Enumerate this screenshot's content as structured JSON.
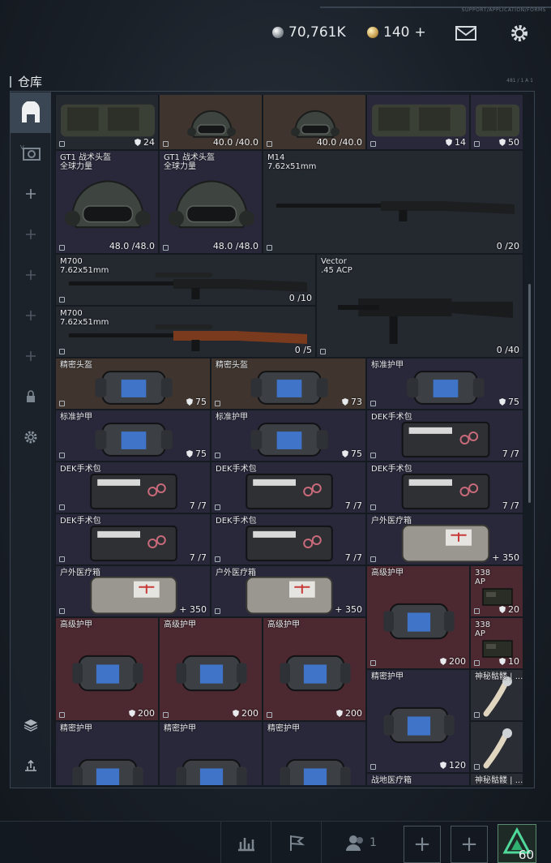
{
  "header": {
    "top_caption": "SUPPORT/APPLICATION/FORMS",
    "silver": "70,761K",
    "gold": "140",
    "gold_add": "+",
    "mail_icon": "mail-icon",
    "settings_icon": "gear-icon"
  },
  "page": {
    "title": "仓库",
    "corner_caption": "481 / 1 A 1"
  },
  "sidebar": [
    {
      "icon": "warehouse-icon",
      "active": true
    },
    {
      "icon": "vehicle-icon"
    },
    {
      "icon": "plus-icon"
    },
    {
      "icon": "plus-icon"
    },
    {
      "icon": "plus-icon"
    },
    {
      "icon": "plus-icon"
    },
    {
      "icon": "plus-icon"
    },
    {
      "icon": "lock-icon"
    },
    {
      "icon": "gear-icon"
    },
    {
      "icon": "layers-icon"
    },
    {
      "icon": "sell-icon"
    }
  ],
  "items": [
    {
      "id": "vest1",
      "name": "",
      "value": "24",
      "art": "vest",
      "color": "dk"
    },
    {
      "id": "helm1",
      "name": "",
      "value": "40.0 /40.0",
      "art": "helmet",
      "color": "br"
    },
    {
      "id": "helm2",
      "name": "",
      "value": "40.0 /40.0",
      "art": "helmet",
      "color": "br"
    },
    {
      "id": "vest2",
      "name": "",
      "value": "14",
      "art": "vest",
      "color": "pu"
    },
    {
      "id": "vest3",
      "name": "",
      "value": "50",
      "art": "vest",
      "color": "pu"
    },
    {
      "id": "gt1a",
      "name": "GT1 战术头盔\n全球力量",
      "value": "48.0 /48.0",
      "art": "helmet",
      "color": "pu"
    },
    {
      "id": "gt1b",
      "name": "GT1 战术头盔\n全球力量",
      "value": "48.0 /48.0",
      "art": "helmet",
      "color": "pu"
    },
    {
      "id": "m14",
      "name": "M14\n7.62x51mm",
      "value": "0 /20",
      "art": "rifle",
      "color": "dk"
    },
    {
      "id": "m700a",
      "name": "M700\n7.62x51mm",
      "value": "0 /10",
      "art": "sniper",
      "color": "dk"
    },
    {
      "id": "vector",
      "name": "Vector\n.45 ACP",
      "value": "0 /40",
      "art": "smg",
      "color": "dk"
    },
    {
      "id": "m700b",
      "name": "M700\n7.62x51mm",
      "value": "0 /5",
      "art": "wood",
      "color": "dk"
    },
    {
      "id": "jmtk1",
      "name": "精密头盔",
      "value": "75",
      "art": "bag",
      "color": "br"
    },
    {
      "id": "jmtk2",
      "name": "精密头盔",
      "value": "73",
      "art": "bag",
      "color": "br"
    },
    {
      "id": "bzhj1",
      "name": "标准护甲",
      "value": "75",
      "art": "bag",
      "color": "pu"
    },
    {
      "id": "bzhj2",
      "name": "标准护甲",
      "value": "75",
      "art": "bag",
      "color": "pu"
    },
    {
      "id": "bzhj3",
      "name": "标准护甲",
      "value": "75",
      "art": "bag",
      "color": "pu"
    },
    {
      "id": "dek1",
      "name": "DEK手术包",
      "value": "7 /7",
      "art": "kit",
      "color": "pu"
    },
    {
      "id": "dek2",
      "name": "DEK手术包",
      "value": "7 /7",
      "art": "kit",
      "color": "pu"
    },
    {
      "id": "dek3",
      "name": "DEK手术包",
      "value": "7 /7",
      "art": "kit",
      "color": "pu"
    },
    {
      "id": "dek4",
      "name": "DEK手术包",
      "value": "7 /7",
      "art": "kit",
      "color": "pu"
    },
    {
      "id": "dek5",
      "name": "DEK手术包",
      "value": "7 /7",
      "art": "kit",
      "color": "pu"
    },
    {
      "id": "dek6",
      "name": "DEK手术包",
      "value": "7 /7",
      "art": "kit",
      "color": "pu"
    },
    {
      "id": "hwyl1",
      "name": "户外医疗箱",
      "value": "+ 350",
      "art": "med",
      "color": "pu"
    },
    {
      "id": "hwyl2",
      "name": "户外医疗箱",
      "value": "+ 350",
      "art": "med",
      "color": "pu"
    },
    {
      "id": "hwyl3",
      "name": "户外医疗箱",
      "value": "+ 350",
      "art": "med",
      "color": "pu"
    },
    {
      "id": "gjhj1",
      "name": "高级护甲",
      "value": "200",
      "art": "bag",
      "color": "rd"
    },
    {
      "id": "ap1",
      "name": "338\nAP",
      "value": "20",
      "art": "ammo",
      "color": "rd"
    },
    {
      "id": "ap2",
      "name": "338\nAP",
      "value": "10",
      "art": "ammo",
      "color": "rd"
    },
    {
      "id": "gjhj2",
      "name": "高级护甲",
      "value": "200",
      "art": "bag",
      "color": "rd"
    },
    {
      "id": "gjhj3",
      "name": "高级护甲",
      "value": "200",
      "art": "bag",
      "color": "rd"
    },
    {
      "id": "gjhj4",
      "name": "高级护甲",
      "value": "200",
      "art": "bag",
      "color": "rd"
    },
    {
      "id": "jmhj1",
      "name": "精密护甲",
      "value": "120",
      "art": "bag",
      "color": "pu"
    },
    {
      "id": "sjqg1",
      "name": "神秘骷髅 | ...",
      "value": "",
      "art": "bone",
      "color": "gy"
    },
    {
      "id": "sjqg2",
      "name": "",
      "value": "",
      "art": "bone",
      "color": "gy"
    },
    {
      "id": "jmhj2",
      "name": "精密护甲",
      "value": "",
      "art": "bag",
      "color": "pu"
    },
    {
      "id": "jmhj3",
      "name": "精密护甲",
      "value": "",
      "art": "bag",
      "color": "pu"
    },
    {
      "id": "jmhj4",
      "name": "精密护甲",
      "value": "",
      "art": "bag",
      "color": "pu"
    },
    {
      "id": "zdyl",
      "name": "战地医疗箱",
      "value": "",
      "art": "none",
      "color": "pu"
    },
    {
      "id": "sjqg3",
      "name": "神秘骷髅 | ...",
      "value": "",
      "art": "none",
      "color": "gy"
    }
  ],
  "bottom": {
    "stats_icon": "stats-icon",
    "flag_icon": "flag-icon",
    "friends_icon": "friends-icon",
    "friends_count": "1",
    "slot_add_label": "+",
    "level": "60",
    "level_icon": "rank-icon"
  }
}
